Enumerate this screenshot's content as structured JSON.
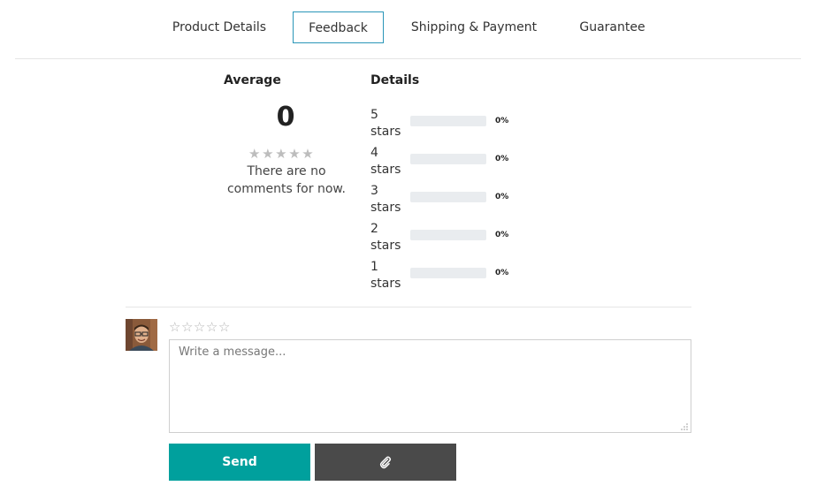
{
  "tabs": [
    {
      "label": "Product Details",
      "active": false
    },
    {
      "label": "Feedback",
      "active": true
    },
    {
      "label": "Shipping & Payment",
      "active": false
    },
    {
      "label": "Guarantee",
      "active": false
    }
  ],
  "rating_summary": {
    "average_heading": "Average",
    "average_value": "0",
    "average_stars_filled": 0,
    "average_stars_total": 5,
    "no_comments_text": "There are no comments for now.",
    "details_heading": "Details",
    "rows": [
      {
        "label_num": "5",
        "label_word": "stars",
        "percent_text": "0%",
        "fraction": 0
      },
      {
        "label_num": "4",
        "label_word": "stars",
        "percent_text": "0%",
        "fraction": 0
      },
      {
        "label_num": "3",
        "label_word": "stars",
        "percent_text": "0%",
        "fraction": 0
      },
      {
        "label_num": "2",
        "label_word": "stars",
        "percent_text": "0%",
        "fraction": 0
      },
      {
        "label_num": "1",
        "label_word": "stars",
        "percent_text": "0%",
        "fraction": 0
      }
    ]
  },
  "composer": {
    "avatar_icon": "user-avatar-photo",
    "rating_stars_total": 5,
    "rating_stars_selected": 0,
    "message_placeholder": "Write a message...",
    "message_value": "",
    "send_label": "Send",
    "attach_icon": "paperclip-icon"
  },
  "colors": {
    "tab_active_border": "#2a96b8",
    "send_button": "#00a09d",
    "attach_button": "#4a4a4a",
    "progress_track": "#e9ecef",
    "star_empty": "#bdbdbd"
  }
}
